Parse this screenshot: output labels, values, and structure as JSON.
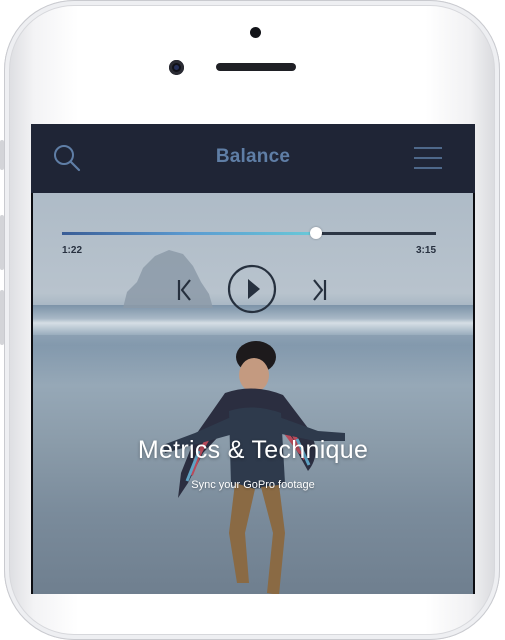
{
  "app": {
    "title": "Balance",
    "search_icon": "search-icon",
    "menu_icon": "hamburger-menu-icon"
  },
  "player": {
    "elapsed": "1:22",
    "total": "3:15",
    "progress": 0.68,
    "prev_icon": "skip-back-icon",
    "play_icon": "play-icon",
    "next_icon": "skip-forward-icon"
  },
  "hero": {
    "headline": "Metrics & Technique",
    "subline": "Sync your GoPro footage"
  },
  "colors": {
    "navbar": "#1f2536",
    "title": "#5f7ea6",
    "progress_start": "#3a5d96",
    "progress_end": "#69c9d8"
  }
}
